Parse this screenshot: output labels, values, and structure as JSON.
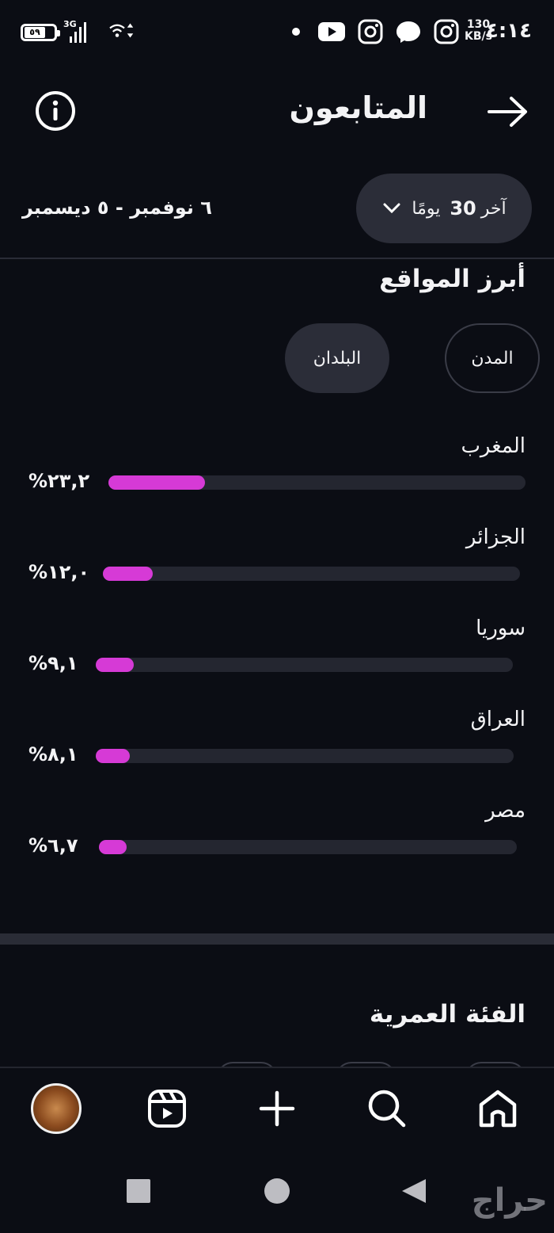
{
  "status_bar": {
    "time": "٤:١٤",
    "speed_value": "130",
    "speed_unit": "KB/s",
    "battery": "٥٩",
    "network": "3G"
  },
  "header": {
    "title": "المتابعون"
  },
  "date_filter": {
    "label_prefix": "آخر",
    "label_number": "30",
    "label_suffix": "يومًا",
    "range": "٦ نوفمبر - ٥ ديسمبر"
  },
  "top_locations": {
    "title": "أبرز المواقع",
    "tabs": [
      {
        "label": "المدن",
        "selected": false
      },
      {
        "label": "البلدان",
        "selected": true
      }
    ],
    "items": [
      {
        "name": "المغرب",
        "percent_label": "%٢٣,٢",
        "value": 23.2
      },
      {
        "name": "الجزائر",
        "percent_label": "%١٢,٠",
        "value": 12.0
      },
      {
        "name": "سوريا",
        "percent_label": "%٩,١",
        "value": 9.1
      },
      {
        "name": "العراق",
        "percent_label": "%٨,١",
        "value": 8.1
      },
      {
        "name": "مصر",
        "percent_label": "%٦,٧",
        "value": 6.7
      }
    ]
  },
  "age_range": {
    "title": "الفئة العمرية"
  },
  "bottom_nav": [
    "home-icon",
    "search-icon",
    "create-icon",
    "reels-icon",
    "profile-avatar"
  ],
  "colors": {
    "background": "#0b0d14",
    "bar_fill": "#d63ad6",
    "bar_track": "#242630",
    "chip_bg": "#2b2d38"
  },
  "watermark": "حراج"
}
